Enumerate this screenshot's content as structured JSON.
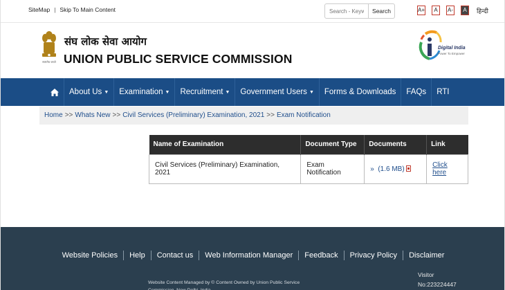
{
  "util": {
    "sitemap": "SiteMap",
    "separator": "|",
    "skip": "Skip To Main Content",
    "search_placeholder": "Search - Keyword",
    "search_button": "Search",
    "font_increase": "A+",
    "font_normal": "A",
    "font_decrease": "A-",
    "font_contrast": "A",
    "hindi": "हिन्दी"
  },
  "header": {
    "title_hindi": "संघ लोक सेवा आयोग",
    "title_english": "UNION PUBLIC SERVICE COMMISSION",
    "emblem_motto": "सत्यमेव जयते",
    "digital_india": "Digital India",
    "digital_india_tagline": "Power To Empower"
  },
  "nav": {
    "home_icon": "home-icon",
    "items": [
      {
        "label": "About Us",
        "dropdown": true
      },
      {
        "label": "Examination",
        "dropdown": true
      },
      {
        "label": "Recruitment",
        "dropdown": true
      },
      {
        "label": "Government Users",
        "dropdown": true
      },
      {
        "label": "Forms & Downloads",
        "dropdown": false
      },
      {
        "label": "FAQs",
        "dropdown": false
      },
      {
        "label": "RTI",
        "dropdown": false
      }
    ]
  },
  "breadcrumb": {
    "home": "Home",
    "whats_new": "Whats New",
    "exam": "Civil Services (Preliminary) Examination, 2021",
    "current": "Exam Notification",
    "sep": ">>"
  },
  "table": {
    "headers": [
      "Name of Examination",
      "Document Type",
      "Documents",
      "Link"
    ],
    "rows": [
      {
        "name": "Civil Services (Preliminary) Examination, 2021",
        "doc_type": "Exam Notification",
        "doc_prefix": "»",
        "doc_size": "(1.6 MB)",
        "link": "Click here"
      }
    ]
  },
  "footer": {
    "links": [
      "Website Policies",
      "Help",
      "Contact us",
      "Web Information Manager",
      "Feedback",
      "Privacy Policy",
      "Disclaimer"
    ],
    "note": "Website Content Managed by © Content Owned by Union Public Service Commission, New Delhi, India.",
    "visitor_label": "Visitor",
    "visitor_count": "No:223224447"
  },
  "colors": {
    "nav_bg": "#1b4d86",
    "footer_bg": "#2b3f4f",
    "table_header_bg": "#2d2d2d",
    "link": "#1f4e8c"
  }
}
